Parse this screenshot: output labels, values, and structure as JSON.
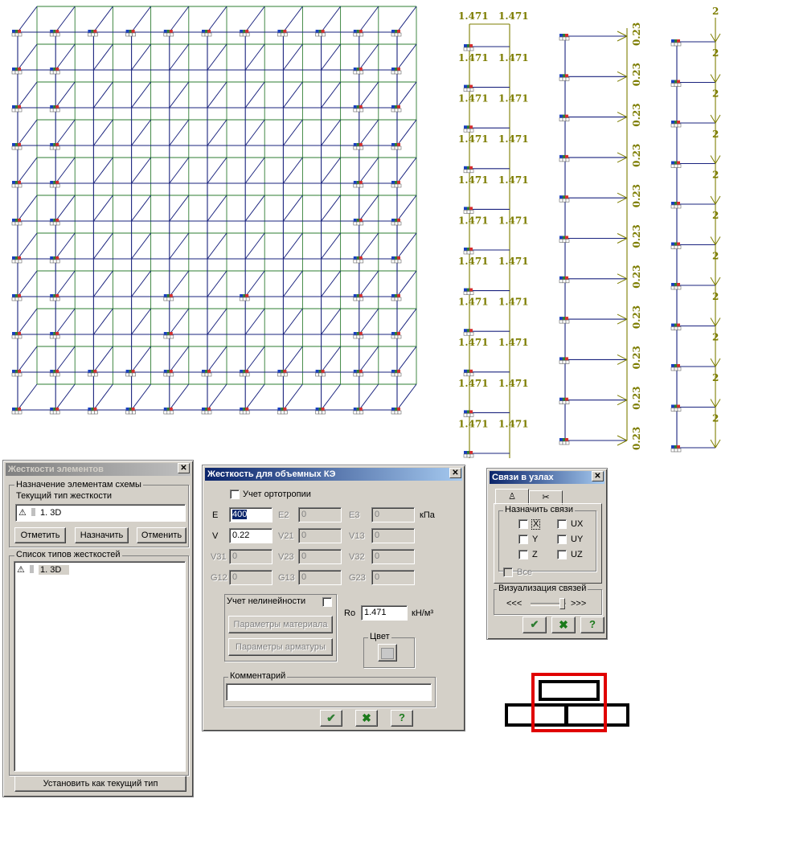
{
  "scheme": {
    "load_labels_1471": "1.471",
    "load_labels_023": "0.23",
    "load_labels_2": "2",
    "colors": {
      "frame": "#1a237e",
      "green_edge": "#2e7d32",
      "load": "#7d7d00",
      "support_red": "#d32f2f",
      "highlight_red": "#e00000"
    }
  },
  "stiffness_panel": {
    "title": "Жесткости элементов",
    "assign_group": "Назначение элементам схемы",
    "current_type_label": "Текущий тип жесткости",
    "current_type_value": "1. 3D",
    "btn_mark": "Отметить",
    "btn_assign": "Назначить",
    "btn_cancel": "Отменить",
    "list_group": "Список типов жесткостей",
    "list_items": [
      "1. 3D"
    ],
    "btn_set_current": "Установить как текущий тип"
  },
  "volume_dialog": {
    "title": "Жесткость для объемных КЭ",
    "orthotropy_label": "Учет ортотропии",
    "E_label": "E",
    "E_value": "400",
    "E2_label": "E2",
    "E2_value": "0",
    "E3_label": "E3",
    "E3_value": "0",
    "unit_kpa": "кПа",
    "V_label": "V",
    "V_value": "0.22",
    "V21_label": "V21",
    "V21_value": "0",
    "V13_label": "V13",
    "V13_value": "0",
    "V31_label": "V31",
    "V31_value": "0",
    "V23_label": "V23",
    "V23_value": "0",
    "V32_label": "V32",
    "V32_value": "0",
    "G12_label": "G12",
    "G12_value": "0",
    "G13_label": "G13",
    "G13_value": "0",
    "G23_label": "G23",
    "G23_value": "0",
    "nonlinear_label": "Учет нелинейности",
    "material_params": "Параметры материала",
    "rebar_params": "Параметры арматуры",
    "ro_label": "Ro",
    "ro_value": "1.471",
    "ro_unit": "кН/м³",
    "color_group": "Цвет",
    "comment_group": "Комментарий",
    "comment_value": ""
  },
  "links_dialog": {
    "title": "Связи в узлах",
    "assign_group": "Назначить связи",
    "chk_x": "X",
    "chk_y": "Y",
    "chk_z": "Z",
    "chk_ux": "UX",
    "chk_uy": "UY",
    "chk_uz": "UZ",
    "all_label": "Все",
    "vis_group": "Визуализация связей",
    "left_arrows": "<<<",
    "right_arrows": ">>>"
  },
  "buttons": {
    "ok": "✔",
    "cancel": "✖",
    "help": "?"
  }
}
